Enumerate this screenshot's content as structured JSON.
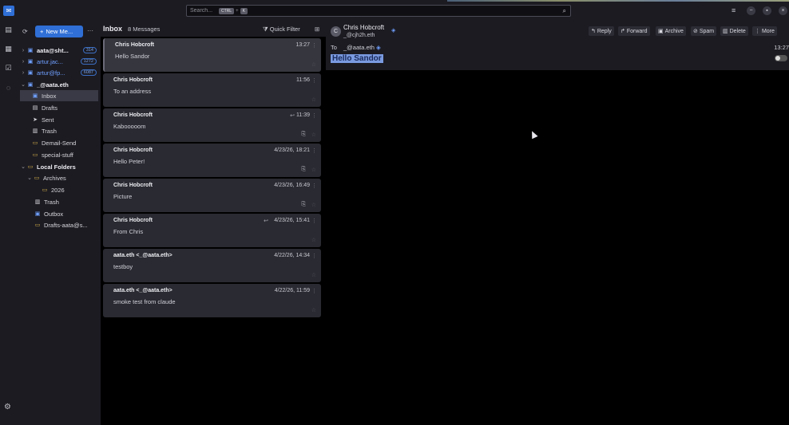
{
  "topbar": {
    "search_placeholder": "Search...",
    "shortcut_key1": "CTRL",
    "shortcut_plus": "+",
    "shortcut_key2": "K",
    "menu_icon": "hamburger-icon",
    "minimize": "−",
    "maximize": "▪",
    "close": "×"
  },
  "folders": {
    "new_message_label": "New Me...",
    "more_label": "···",
    "items": [
      {
        "label": "aata@sht...",
        "badge": "314",
        "icon": "inbox-icon",
        "twisty": "›",
        "style": "bold"
      },
      {
        "label": "artur.jac...",
        "badge": "1272",
        "icon": "inbox-icon",
        "twisty": "›",
        "style": "blue"
      },
      {
        "label": "artur@fp...",
        "badge": "6087",
        "icon": "inbox-icon",
        "twisty": "›",
        "style": "blue"
      },
      {
        "label": "_@aata.eth",
        "badge": "",
        "icon": "inbox-icon",
        "twisty": "⌄",
        "style": "bold"
      },
      {
        "label": "Inbox",
        "icon": "inbox-icon"
      },
      {
        "label": "Drafts",
        "icon": "drafts-icon"
      },
      {
        "label": "Sent",
        "icon": "sent-icon"
      },
      {
        "label": "Trash",
        "icon": "trash-icon"
      },
      {
        "label": "Demail-Send",
        "icon": "folder-icon"
      },
      {
        "label": "special-stuff",
        "icon": "folder-icon"
      },
      {
        "label": "Local Folders",
        "icon": "folder-icon",
        "twisty": "⌄"
      },
      {
        "label": "Archives",
        "icon": "folder-icon",
        "twisty": "⌄"
      },
      {
        "label": "2026",
        "icon": "folder-icon"
      },
      {
        "label": "Trash",
        "icon": "trash-icon"
      },
      {
        "label": "Outbox",
        "icon": "outbox-icon"
      },
      {
        "label": "Drafts-aata@s...",
        "icon": "folder-icon"
      }
    ]
  },
  "list": {
    "title": "Inbox",
    "count": "8 Messages",
    "quick_filter": "Quick Filter",
    "messages": [
      {
        "from": "Chris Hobcroft",
        "subject": "Hello Sandor",
        "date": "13:27",
        "attach": false,
        "replied": false
      },
      {
        "from": "Chris Hobcroft",
        "subject": "To an address",
        "date": "11:56",
        "attach": false,
        "replied": false
      },
      {
        "from": "Chris Hobcroft",
        "subject": "Kabooooom",
        "date": "11:39",
        "attach": true,
        "replied": true
      },
      {
        "from": "Chris Hobcroft",
        "subject": "Hello Peter!",
        "date": "4/23/26, 18:21",
        "attach": true,
        "replied": false
      },
      {
        "from": "Chris Hobcroft",
        "subject": "Picture",
        "date": "4/23/26, 16:49",
        "attach": true,
        "replied": false
      },
      {
        "from": "Chris Hobcroft",
        "subject": "From Chris",
        "date": "4/23/26, 15:41",
        "attach": false,
        "replied": true
      },
      {
        "from": "aata.eth <_@aata.eth>",
        "subject": "testboy",
        "date": "4/22/26, 14:34",
        "attach": false,
        "replied": false
      },
      {
        "from": "aata.eth <_@aata.eth>",
        "subject": "smoke test from claude",
        "date": "4/22/26, 11:59",
        "attach": false,
        "replied": false
      }
    ]
  },
  "reader": {
    "avatar_letter": "C",
    "sender_name": "Chris Hobcroft",
    "sender_address": "_@cjh2h.eth",
    "actions": {
      "reply": "Reply",
      "forward": "Forward",
      "archive": "Archive",
      "spam": "Spam",
      "delete": "Delete",
      "more": "More"
    },
    "to_label": "To",
    "to_value": "_@aata.eth",
    "time": "13:27",
    "subject": "Hello Sandor"
  }
}
